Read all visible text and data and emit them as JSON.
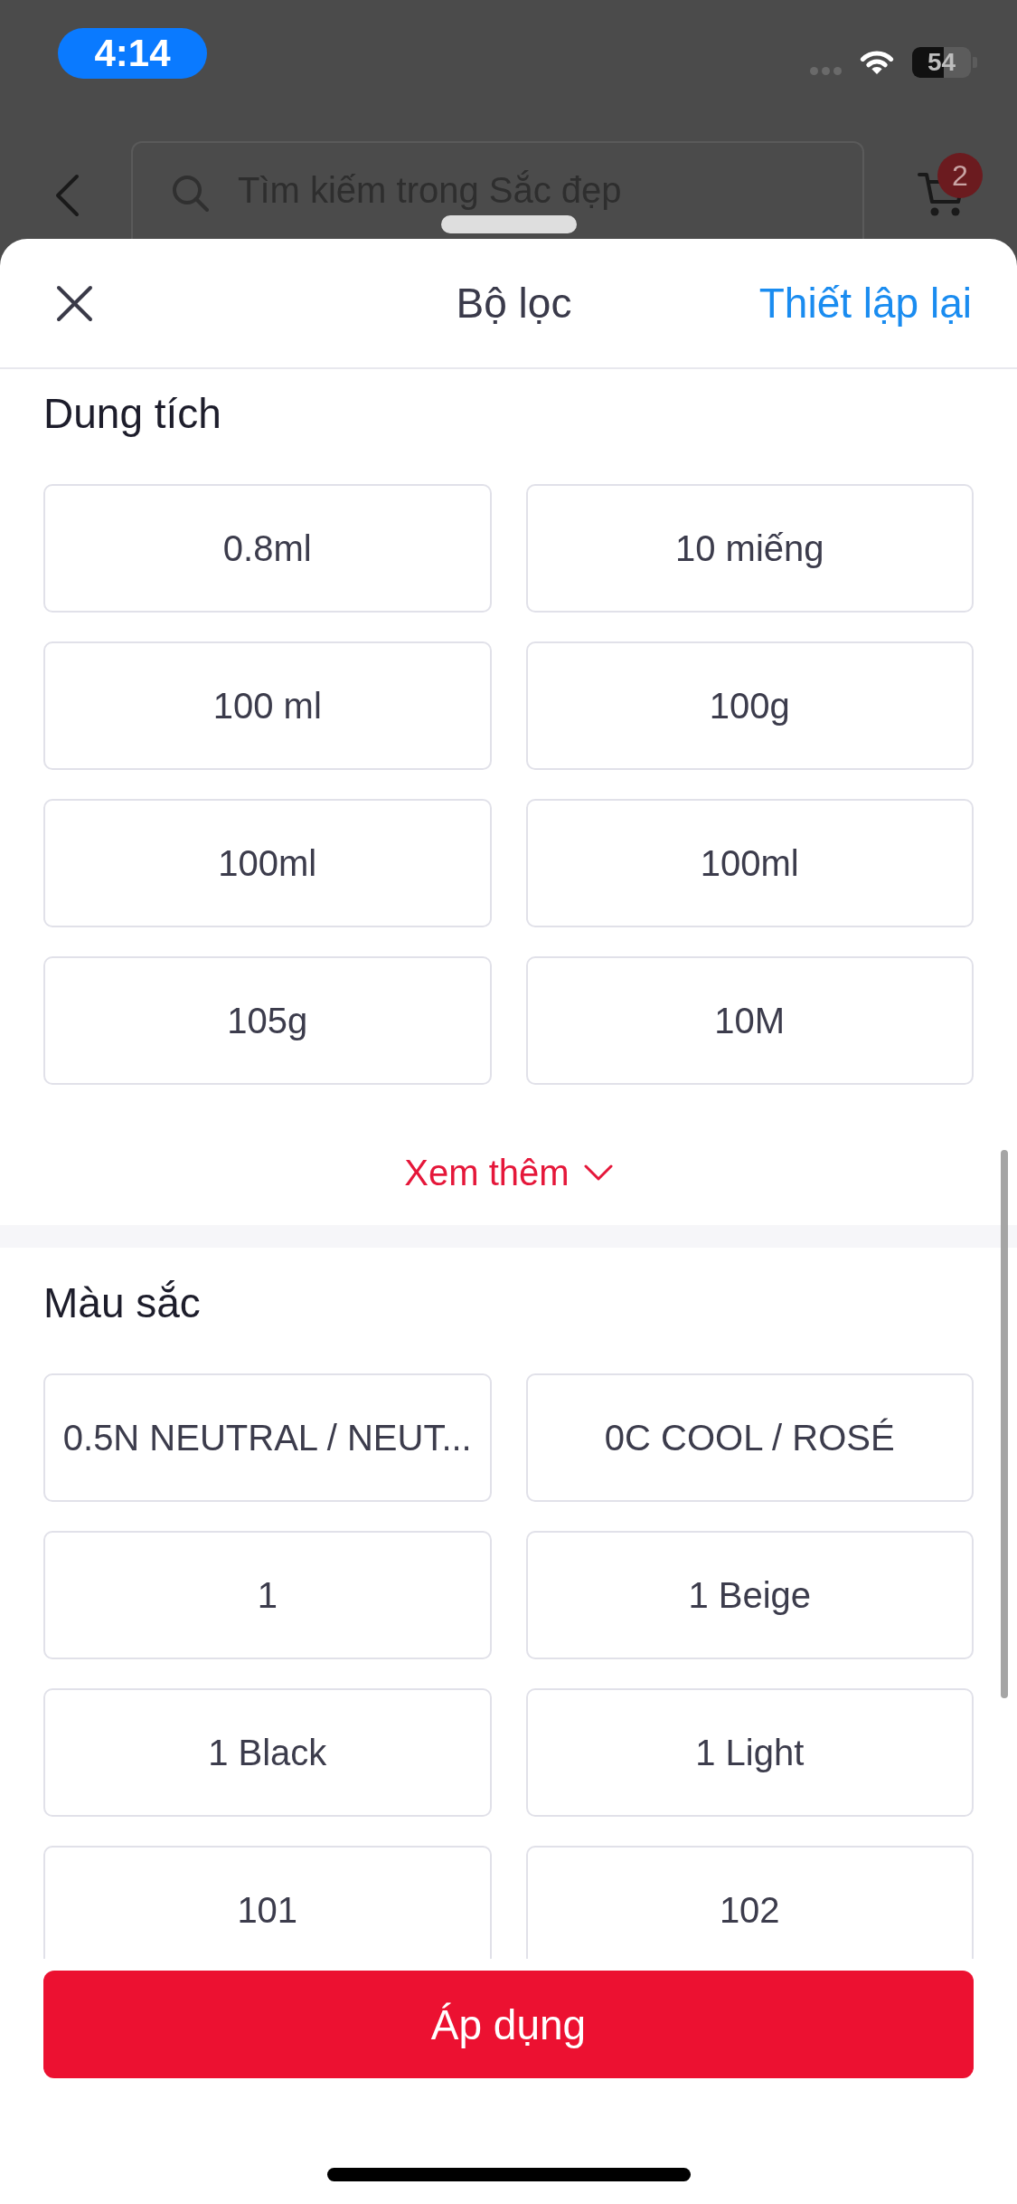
{
  "status_bar": {
    "time": "4:14",
    "battery": "54"
  },
  "nav_bar": {
    "search": {
      "placeholder": "Tìm kiếm trong Sắc đẹp"
    },
    "cart_badge": "2"
  },
  "filter_sheet": {
    "title": "Bộ lọc",
    "reset": "Thiết lập lại",
    "sections": [
      {
        "title": "Dung tích",
        "options": [
          {
            "label": "0.8ml",
            "selected": false
          },
          {
            "label": "10 miếng",
            "selected": false
          },
          {
            "label": "100 ml",
            "selected": false
          },
          {
            "label": "100g",
            "selected": false
          },
          {
            "label": "100ml",
            "selected": false
          },
          {
            "label": "100ml",
            "selected": false
          },
          {
            "label": "105g",
            "selected": false
          },
          {
            "label": "10M",
            "selected": false
          }
        ],
        "more": "Xem thêm"
      },
      {
        "title": "Màu sắc",
        "options": [
          {
            "label": "0.5N NEUTRAL / NEUT...",
            "selected": false
          },
          {
            "label": "0C COOL / ROSÉ",
            "selected": false
          },
          {
            "label": "1",
            "selected": false
          },
          {
            "label": "1 Beige",
            "selected": false
          },
          {
            "label": "1 Black",
            "selected": false
          },
          {
            "label": "1 Light",
            "selected": false
          },
          {
            "label": "101",
            "selected": false
          },
          {
            "label": "102",
            "selected": false
          }
        ]
      }
    ],
    "apply_button": "Áp dụng"
  }
}
